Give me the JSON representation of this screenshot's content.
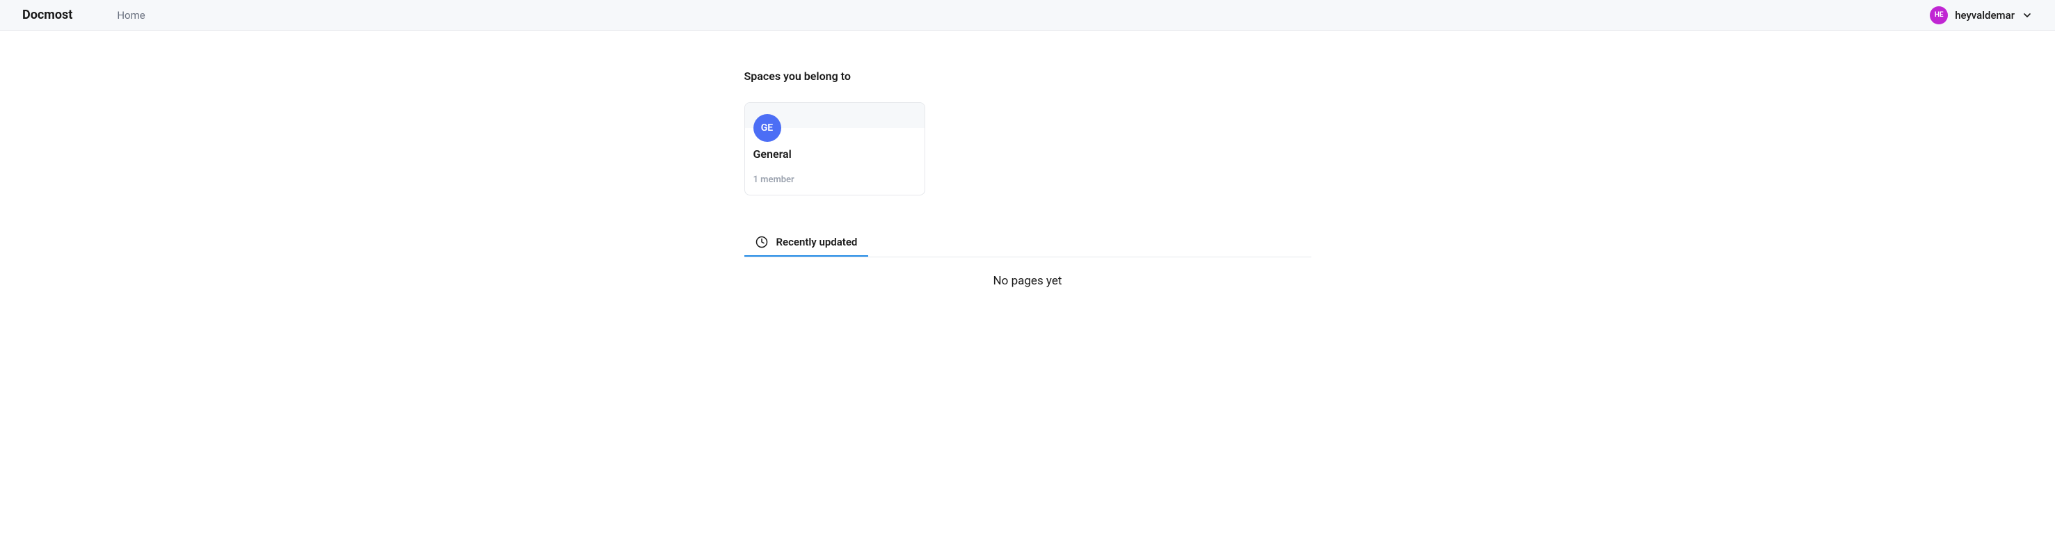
{
  "header": {
    "brand": "Docmost",
    "nav_home": "Home",
    "user": {
      "avatar_initials": "HE",
      "name": "heyvaldemar"
    }
  },
  "main": {
    "spaces_title": "Spaces you belong to",
    "spaces": [
      {
        "avatar_initials": "GE",
        "name": "General",
        "members": "1 member"
      }
    ],
    "tabs": [
      {
        "label": "Recently updated"
      }
    ],
    "empty_state": "No pages yet"
  }
}
